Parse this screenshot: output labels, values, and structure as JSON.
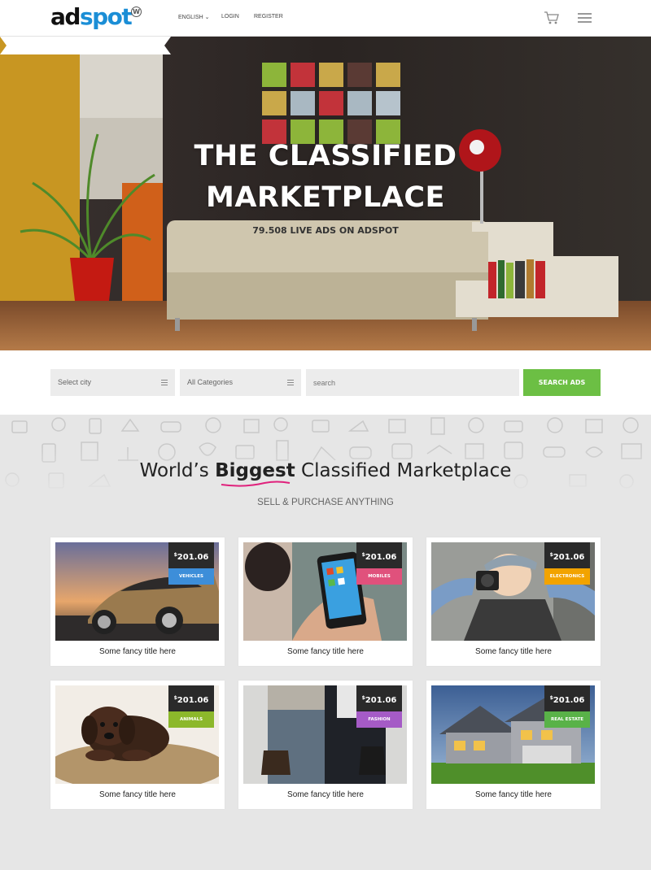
{
  "header": {
    "logo_ad": "ad",
    "logo_spot": "spot",
    "logo_mark": "W",
    "nav": {
      "language": "ENGLISH ⌄",
      "login": "LOGIN",
      "register": "REGISTER"
    },
    "icons": [
      "cart-icon",
      "menu-icon"
    ]
  },
  "hero": {
    "title_line1": "THE CLASSIFIED",
    "title_line2": "MARKETPLACE",
    "ribbon": "79.508 LIVE ADS ON ADSPOT"
  },
  "search": {
    "city_value": "Select city",
    "category_value": "All Categories",
    "input_placeholder": "search",
    "button_label": "SEARCH ADS"
  },
  "section": {
    "title_before": "World’s ",
    "title_bold": "Biggest",
    "title_after": " Classified Marketplace",
    "subtitle": "SELL & PURCHASE ANYTHING"
  },
  "cards": [
    {
      "price_symbol": "$",
      "price": "201.06",
      "category": "VEHICLES",
      "category_color": "#3d8ed9",
      "title": "Some fancy title here"
    },
    {
      "price_symbol": "$",
      "price": "201.06",
      "category": "MOBILES",
      "category_color": "#e0517c",
      "title": "Some fancy title here"
    },
    {
      "price_symbol": "$",
      "price": "201.06",
      "category": "ELECTRONICS",
      "category_color": "#f2a300",
      "title": "Some fancy title here"
    },
    {
      "price_symbol": "$",
      "price": "201.06",
      "category": "ANIMALS",
      "category_color": "#8cb82b",
      "title": "Some fancy title here"
    },
    {
      "price_symbol": "$",
      "price": "201.06",
      "category": "FASHION",
      "category_color": "#a55bc6",
      "title": "Some fancy title here"
    },
    {
      "price_symbol": "$",
      "price": "201.06",
      "category": "REAL ESTATE",
      "category_color": "#59b248",
      "title": "Some fancy title here"
    }
  ],
  "colors": {
    "accent_green": "#6cbf44",
    "logo_blue": "#1b8ed6",
    "underline_pink": "#e0217c"
  }
}
